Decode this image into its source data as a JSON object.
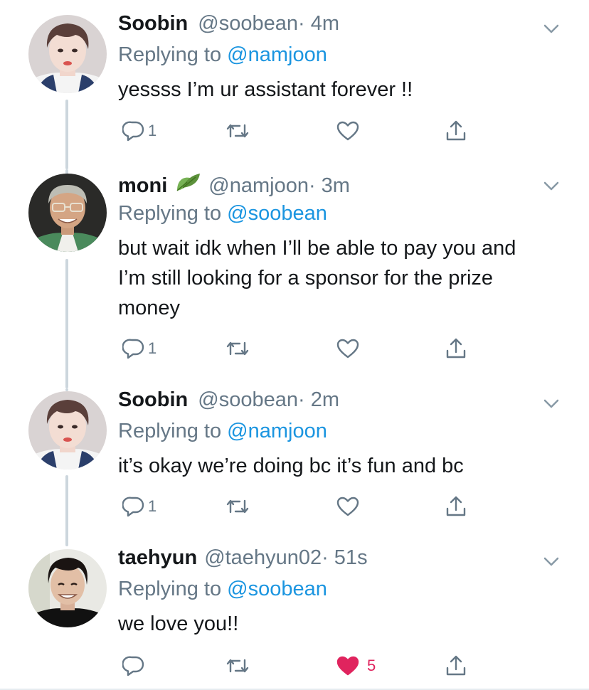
{
  "tweets": [
    {
      "name": "Soobin",
      "handle": "@soobean",
      "time": "· 4m",
      "replying_prefix": "Replying to",
      "replying_to": "@namjoon",
      "text": "yessss I’m ur assistant forever !!",
      "reply_count": "1",
      "like_count": ""
    },
    {
      "name": "moni",
      "handle": "@namjoon",
      "time": "· 3m",
      "replying_prefix": "Replying to",
      "replying_to": "@soobean",
      "text": "but wait idk when I’ll be able to pay you and I’m still looking for a sponsor for the prize money",
      "reply_count": "1",
      "like_count": ""
    },
    {
      "name": "Soobin",
      "handle": "@soobean",
      "time": "· 2m",
      "replying_prefix": "Replying to",
      "replying_to": "@namjoon",
      "text": "it’s okay we’re doing bc it’s fun and bc",
      "reply_count": "1",
      "like_count": ""
    },
    {
      "name": "taehyun",
      "handle": "@taehyun02",
      "time": "· 51s",
      "replying_prefix": "Replying to",
      "replying_to": "@soobean",
      "text": "we love you!!",
      "reply_count": "",
      "like_count": "5"
    }
  ],
  "colors": {
    "text": "#14171a",
    "secondary": "#657786",
    "link": "#1b95e0",
    "like": "#e0245e",
    "thread_line": "#ccd6dd"
  },
  "icons": [
    "chevron-down-icon",
    "reply-icon",
    "retweet-icon",
    "heart-icon",
    "share-icon",
    "leaf-emoji"
  ]
}
